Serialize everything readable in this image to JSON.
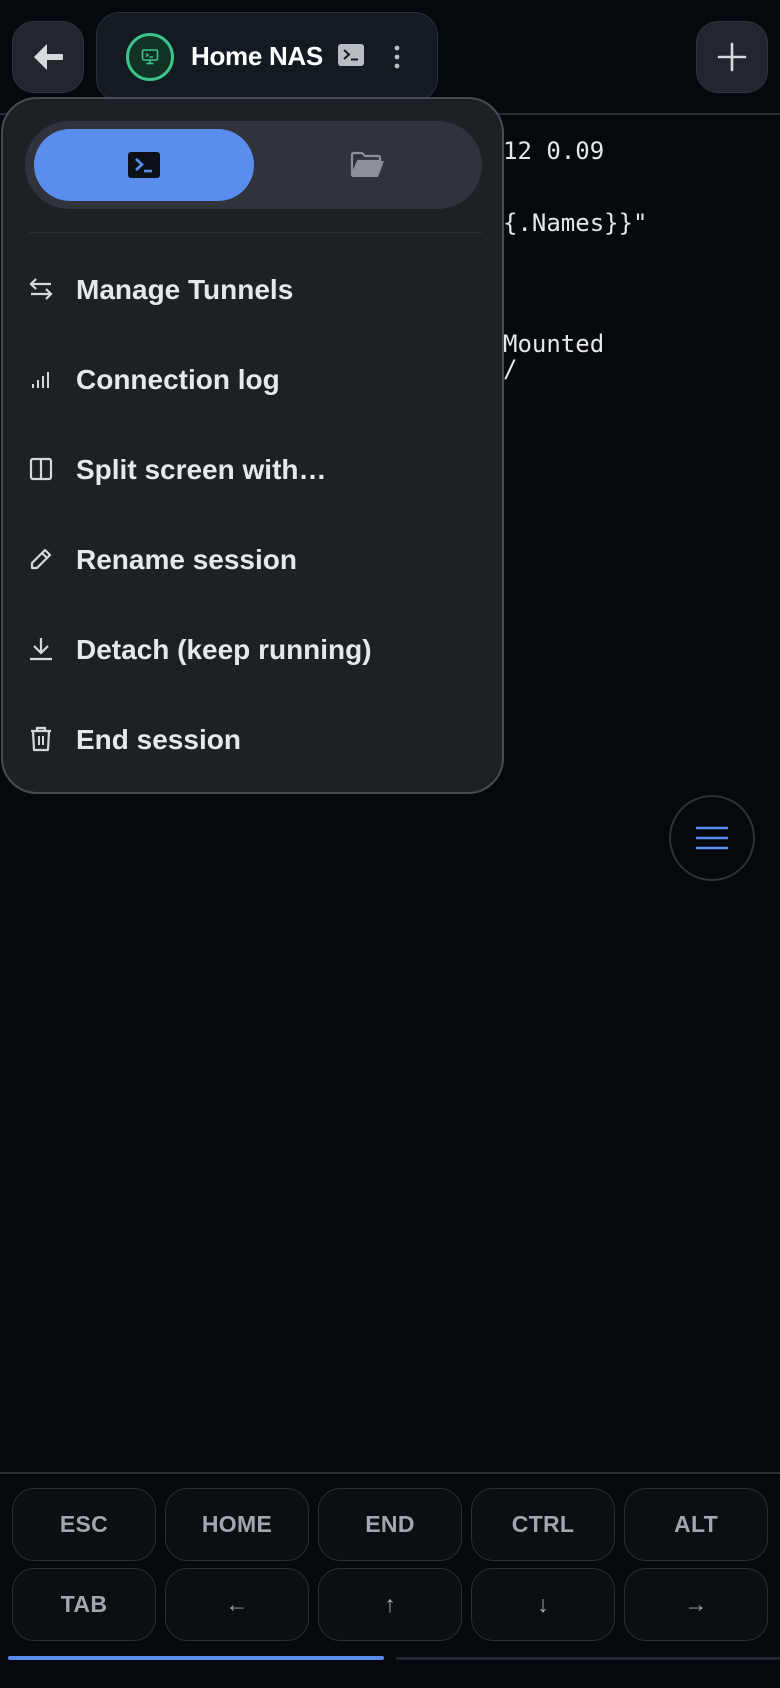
{
  "header": {
    "back_icon": "arrow-left-icon",
    "session_name": "Home NAS",
    "session_avatar_icon": "server-terminal-icon",
    "session_type_icon": "terminal-icon",
    "more_icon": "kebab-vertical-icon",
    "add_icon": "plus-icon"
  },
  "terminal": {
    "lines": [
      "12 0.09",
      "{.Names}}\"",
      "Mounted",
      "/"
    ]
  },
  "menu": {
    "segments": [
      {
        "id": "terminal",
        "icon": "terminal-icon",
        "active": true
      },
      {
        "id": "files",
        "icon": "folder-open-icon",
        "active": false
      }
    ],
    "items": [
      {
        "label": "Manage Tunnels",
        "icon": "swap-arrows-icon"
      },
      {
        "label": "Connection log",
        "icon": "signal-bars-icon"
      },
      {
        "label": "Split screen with…",
        "icon": "split-panel-icon"
      },
      {
        "label": "Rename session",
        "icon": "pencil-icon"
      },
      {
        "label": "Detach (keep running)",
        "icon": "download-icon"
      },
      {
        "label": "End session",
        "icon": "trash-icon"
      }
    ]
  },
  "fab": {
    "icon": "hamburger-menu-icon"
  },
  "keys": {
    "row1": [
      "ESC",
      "HOME",
      "END",
      "CTRL",
      "ALT"
    ],
    "row2": [
      "TAB",
      "←",
      "↑",
      "↓",
      "→"
    ]
  },
  "pager": {
    "page": 1,
    "pages": 2
  },
  "colors": {
    "accent": "#5b8def",
    "status_online": "#3cc48a",
    "background": "#05090d",
    "menu_background": "#1d2025"
  }
}
